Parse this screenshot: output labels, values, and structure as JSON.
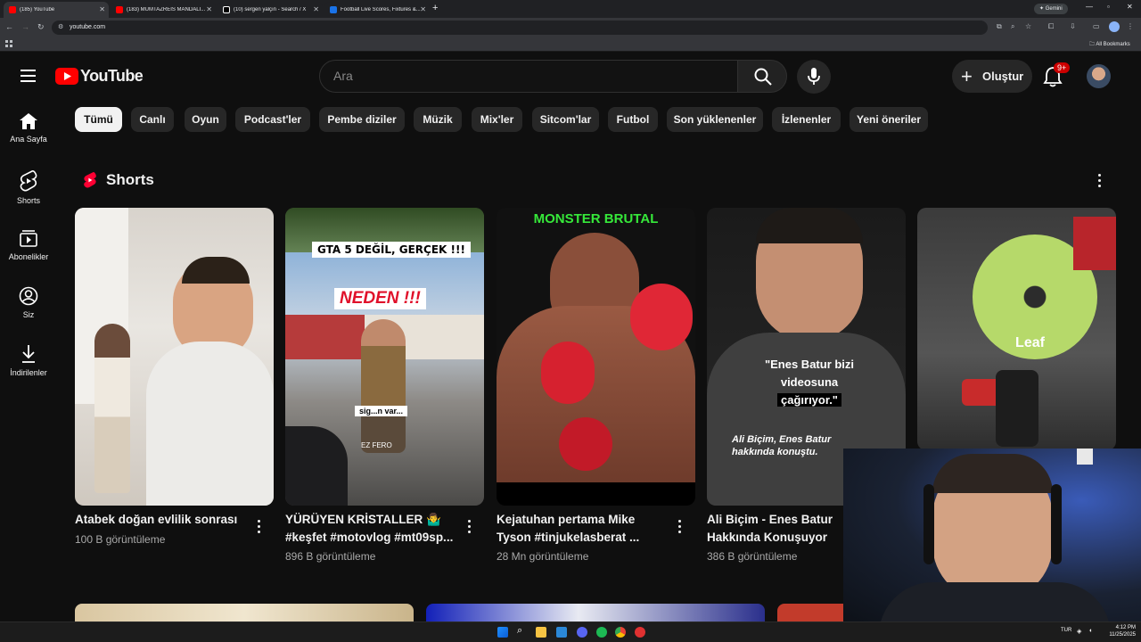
{
  "browser": {
    "tabs": [
      {
        "label": "(185) YouTube",
        "color": "#ff0000"
      },
      {
        "label": "(183) MÜMTAZREİS MANDALİ...",
        "color": "#ff0000"
      },
      {
        "label": "(10) sergen yalçın - Search / X",
        "color": "#ffffff"
      },
      {
        "label": "Football Live Scores, Fixtures &...",
        "color": "#1a73e8"
      }
    ],
    "url": "youtube.com",
    "gemini_label": "Gemini",
    "bookmarks_label": "All Bookmarks"
  },
  "header": {
    "logo_text": "YouTube",
    "search_placeholder": "Ara",
    "create_label": "Oluştur",
    "notification_count": "9+"
  },
  "chips": [
    "Tümü",
    "Canlı",
    "Oyun",
    "Podcast'ler",
    "Pembe diziler",
    "Müzik",
    "Mix'ler",
    "Sitcom'lar",
    "Futbol",
    "Son yüklenenler",
    "İzlenenler",
    "Yeni öneriler"
  ],
  "sidebar": [
    {
      "label": "Ana Sayfa",
      "icon": "home-icon"
    },
    {
      "label": "Shorts",
      "icon": "shorts-icon"
    },
    {
      "label": "Abonelikler",
      "icon": "subscriptions-icon"
    },
    {
      "label": "Siz",
      "icon": "you-icon"
    },
    {
      "label": "İndirilenler",
      "icon": "downloads-icon"
    }
  ],
  "shorts": {
    "section_title": "Shorts",
    "items": [
      {
        "title": "Atabek doğan evlilik sonrası",
        "views": "100 B görüntüleme",
        "overlay": ""
      },
      {
        "title": "YÜRÜYEN KRİSTALLER 🤷‍♂️ #keşfet #motovlog #mt09sp...",
        "views": "896 B görüntüleme",
        "overlay_top": "GTA 5 DEĞİL, GERÇEK !!!",
        "overlay_mid": "NEDEN !!!",
        "overlay_bottom": "sig...n var...",
        "overlay_tag": "EZ FERO"
      },
      {
        "title": "Kejatuhan pertama Mike Tyson #tinjukelasberat ...",
        "views": "28 Mn görüntüleme",
        "overlay_top": "MONSTER BRUTAL"
      },
      {
        "title": "Ali Biçim - Enes Batur Hakkında Konuşuyor",
        "views": "386 B görüntüleme",
        "overlay_quote": "\"Enes Batur bizi videosuna",
        "overlay_quote2": "çağırıyor.\"",
        "overlay_caption": "Ali Biçim, Enes Batur hakkında konuştu."
      },
      {
        "title": "",
        "views": "",
        "overlay_label": "Leaf"
      }
    ]
  },
  "taskbar": {
    "lang": "TUR",
    "time": "4:12 PM",
    "date": "11/25/2025"
  }
}
